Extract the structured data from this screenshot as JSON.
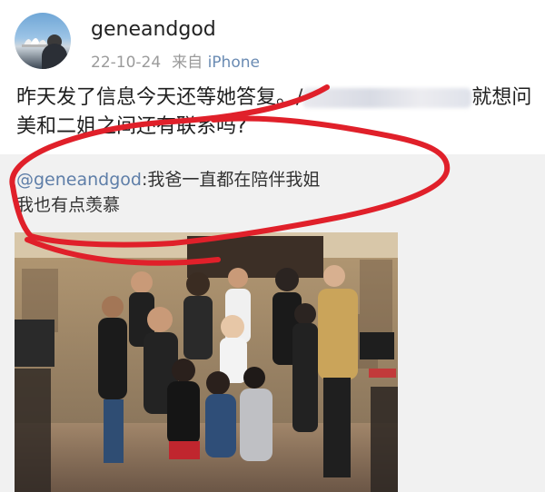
{
  "post": {
    "username": "geneandgod",
    "date": "22-10-24",
    "source_prefix": "来自",
    "source": "iPhone",
    "text_line1_start": "昨天发了信息今天还等她答复。/",
    "text_line1_end": "就想问",
    "text_line2": "美和二姐之间还有联系吗?"
  },
  "repost": {
    "mention": "@geneandgod",
    "text_line1": ":我爸一直都在陪伴我姐",
    "text_line2": "我也有点羡慕"
  },
  "colors": {
    "link": "#5e7ea8",
    "meta": "#9b9b9b",
    "annotation": "#e0202a"
  }
}
